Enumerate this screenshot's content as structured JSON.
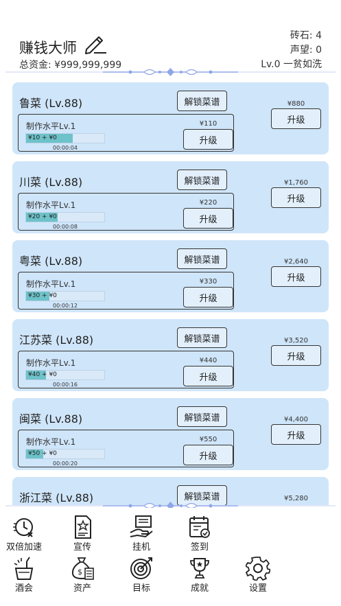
{
  "header": {
    "title": "赚钱大师",
    "total_funds": "总资金: ¥999,999,999",
    "bricks": "砖石: 4",
    "reputation": "声望: 0",
    "level": "Lv.0 一贫如洗"
  },
  "labels": {
    "unlock": "解锁菜谱",
    "upgrade": "升级",
    "make_level": "制作水平Lv.1"
  },
  "dishes": [
    {
      "name": "鲁菜 (Lv.88)",
      "inner_price": "¥110",
      "progress_text": "¥10 + ¥0",
      "progress": 0.6,
      "timer": "00:00:04",
      "upgrade_price": "¥880"
    },
    {
      "name": "川菜 (Lv.88)",
      "inner_price": "¥220",
      "progress_text": "¥20 + ¥0",
      "progress": 0.4,
      "timer": "00:00:08",
      "upgrade_price": "¥1,760"
    },
    {
      "name": "粤菜 (Lv.88)",
      "inner_price": "¥330",
      "progress_text": "¥30 + ¥0",
      "progress": 0.3,
      "timer": "00:00:12",
      "upgrade_price": "¥2,640"
    },
    {
      "name": "江苏菜 (Lv.88)",
      "inner_price": "¥440",
      "progress_text": "¥40 + ¥0",
      "progress": 0.25,
      "timer": "00:00:16",
      "upgrade_price": "¥3,520"
    },
    {
      "name": "闽菜 (Lv.88)",
      "inner_price": "¥550",
      "progress_text": "¥50 + ¥0",
      "progress": 0.22,
      "timer": "00:00:20",
      "upgrade_price": "¥4,400"
    },
    {
      "name": "浙江菜 (Lv.88)",
      "upgrade_price": "¥5,280"
    }
  ],
  "nav": {
    "double_speed": "双倍加速",
    "promote": "宣传",
    "idle": "挂机",
    "sign_in": "签到",
    "banquet": "酒会",
    "assets": "资产",
    "goals": "目标",
    "achievements": "成就",
    "settings": "设置"
  },
  "colors": {
    "card_bg": "#cfe5f9",
    "progress_fill": "#6ec2c9",
    "ornament": "#8fa6e8"
  }
}
